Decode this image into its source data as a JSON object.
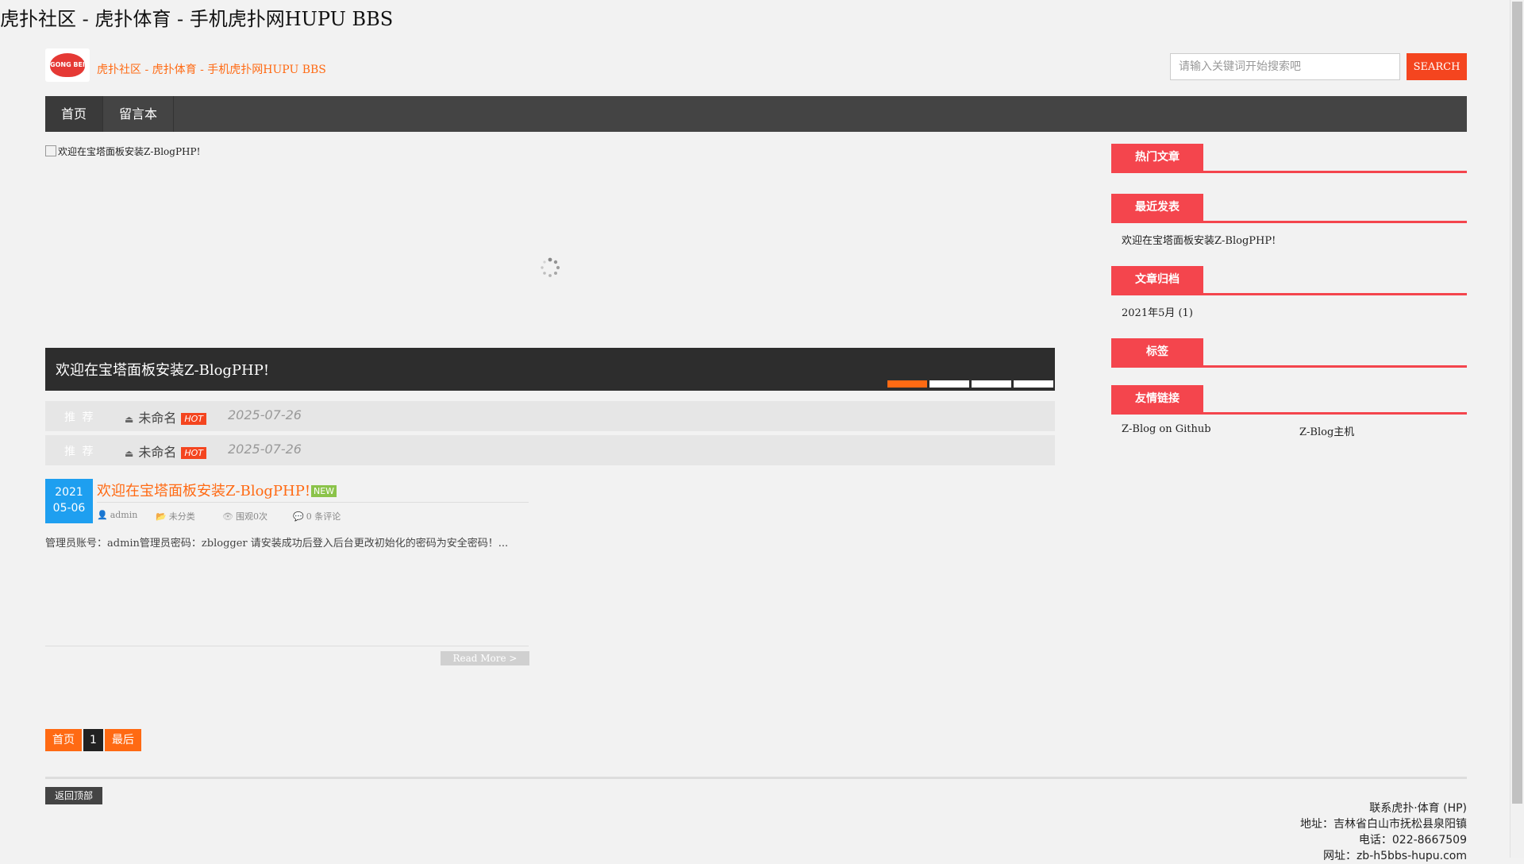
{
  "page": {
    "window_title": "虎扑社区 - 虎扑体育 - 手机虎扑网HUPU BBS"
  },
  "header": {
    "logo_text": "GONG BEI",
    "site_title": "虎扑社区 - 虎扑体育 - 手机虎扑网HUPU BBS",
    "search_placeholder": "请输入关键词开始搜索吧",
    "search_button": "SEARCH"
  },
  "nav": {
    "items": [
      {
        "label": "首页"
      },
      {
        "label": "留言本"
      }
    ]
  },
  "slider": {
    "image_alt": "欢迎在宝塔面板安装Z-BlogPHP!",
    "caption": "欢迎在宝塔面板安装Z-BlogPHP!",
    "dot_count": 4,
    "active_dot": 0,
    "accent_color": "#ff6a13"
  },
  "recommended": [
    {
      "label": "推 荐",
      "title": "未命名",
      "badge": "HOT",
      "date": "2025-07-26"
    },
    {
      "label": "推 荐",
      "title": "未命名",
      "badge": "HOT",
      "date": "2025-07-26"
    }
  ],
  "post": {
    "year": "2021",
    "month_day": "05-06",
    "title": "欢迎在宝塔面板安装Z-BlogPHP!",
    "badge": "NEW",
    "author": "admin",
    "category": "未分类",
    "views": "围观0次",
    "comments": "0 条评论",
    "excerpt": "管理员账号：admin管理员密码：zblogger 请安装成功后登入后台更改初始化的密码为安全密码！...",
    "read_more": "Read More >"
  },
  "pagination": {
    "first": "首页",
    "current": "1",
    "last": "最后"
  },
  "footer": {
    "back_to_top": "返回顶部",
    "contact": "联系虎扑·体育 (HP)",
    "address": "地址：吉林省白山市抚松县泉阳镇",
    "phone": "电话：022-8667509",
    "website": "网址：zb-h5bbs-hupu.com"
  },
  "sidebar": {
    "hot_title": "热门文章",
    "recent_title": "最近发表",
    "recent_items": [
      "欢迎在宝塔面板安装Z-BlogPHP!"
    ],
    "archive_title": "文章归档",
    "archive_items": [
      "2021年5月 (1)"
    ],
    "tags_title": "标签",
    "links_title": "友情链接",
    "links": [
      "Z-Blog on Github",
      "Z-Blog主机"
    ]
  },
  "colors": {
    "brand_orange": "#ff6a13",
    "widget_red": "#f4454d",
    "nav_dark": "#444444",
    "date_blue": "#1e9ff0",
    "new_green": "#8bc34a"
  }
}
